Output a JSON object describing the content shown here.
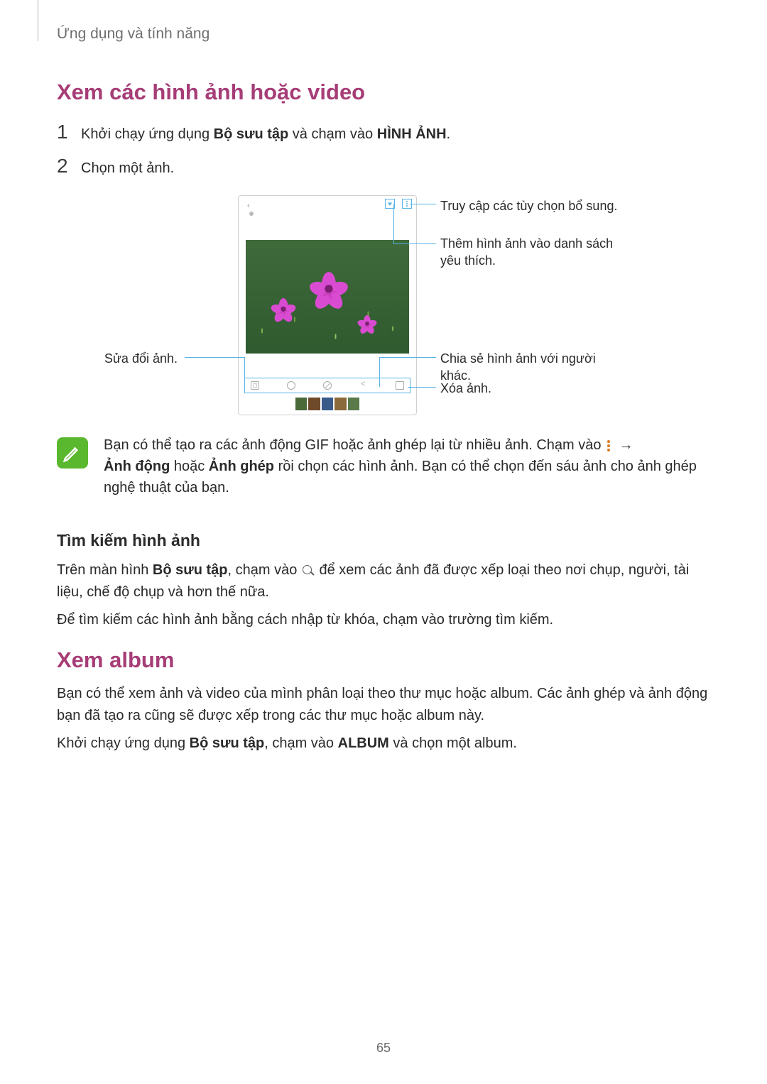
{
  "header": "Ứng dụng và tính năng",
  "section1_title": "Xem các hình ảnh hoặc video",
  "step1": {
    "num": "1",
    "text_before": "Khởi chạy ứng dụng ",
    "app": "Bộ sưu tập",
    "text_mid": " và chạm vào ",
    "tab": "HÌNH ẢNH",
    "text_after": "."
  },
  "step2": {
    "num": "2",
    "text": "Chọn một ảnh."
  },
  "callouts": {
    "more": "Truy cập các tùy chọn bổ sung.",
    "fav": "Thêm hình ảnh vào danh sách yêu thích.",
    "edit": "Sửa đổi ảnh.",
    "share": "Chia sẻ hình ảnh với người khác.",
    "delete": "Xóa ảnh."
  },
  "tip": {
    "line1_a": "Bạn có thể tạo ra các ảnh động GIF hoặc ảnh ghép lại từ nhiều ảnh. Chạm vào ",
    "line1_arrow": "→",
    "line2_a": "Ảnh động",
    "line2_or": " hoặc ",
    "line2_b": "Ảnh ghép",
    "line2_rest": " rồi chọn các hình ảnh. Bạn có thể chọn đến sáu ảnh cho ảnh ghép nghệ thuật của bạn."
  },
  "sub_title": "Tìm kiếm hình ảnh",
  "para1_a": "Trên màn hình ",
  "para1_b": "Bộ sưu tập",
  "para1_c": ", chạm vào ",
  "para1_d": " để xem các ảnh đã được xếp loại theo nơi chụp, người, tài liệu, chế độ chụp và hơn thế nữa.",
  "para2": "Để tìm kiếm các hình ảnh bằng cách nhập từ khóa, chạm vào trường tìm kiếm.",
  "section2_title": "Xem album",
  "para3": "Bạn có thể xem ảnh và video của mình phân loại theo thư mục hoặc album. Các ảnh ghép và ảnh động bạn đã tạo ra cũng sẽ được xếp trong các thư mục hoặc album này.",
  "para4_a": "Khởi chạy ứng dụng ",
  "para4_b": "Bộ sưu tập",
  "para4_c": ", chạm vào ",
  "para4_d": "ALBUM",
  "para4_e": " và chọn một album.",
  "page_number": "65"
}
